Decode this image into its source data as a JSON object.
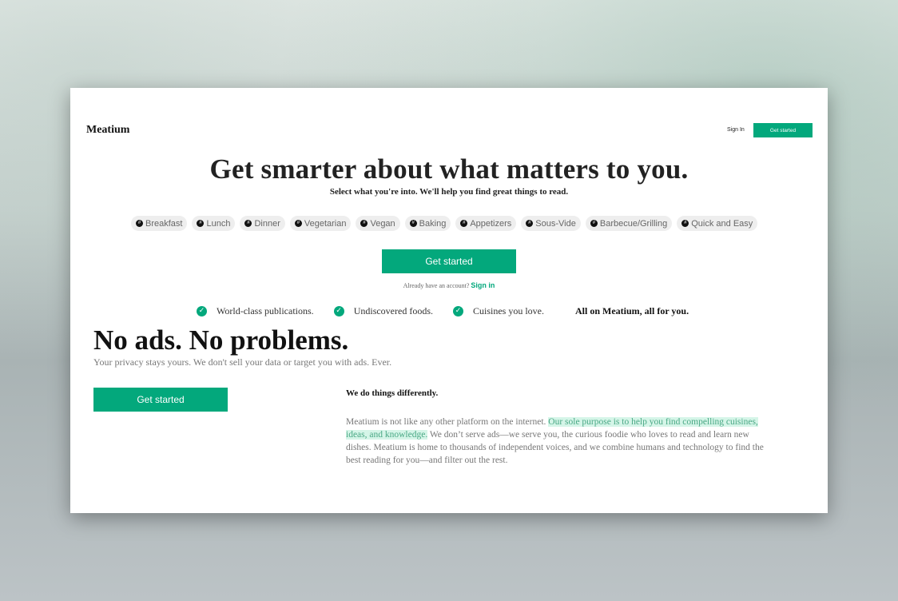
{
  "header": {
    "logo": "Meatium",
    "sign_in": "Sign In",
    "get_started": "Get started"
  },
  "hero": {
    "title": "Get smarter about what matters to you.",
    "subtitle": "Select what you're into. We'll help you find great things to read."
  },
  "tags": [
    "Breakfast",
    "Lunch",
    "Dinner",
    "Vegetarian",
    "Vegan",
    "Baking",
    "Appetizers",
    "Sous-Vide",
    "Barbecue/Grilling",
    "Quick and Easy"
  ],
  "cta": {
    "label": "Get started",
    "already": "Already have an account?",
    "sign_in": "Sign in"
  },
  "features": {
    "items": [
      "World-class publications.",
      "Undiscovered foods.",
      "Cuisines you love."
    ],
    "final": "All on Meatium, all for you."
  },
  "no_ads": {
    "title": "No ads. No problems.",
    "subtitle": "Your privacy stays yours. We don't sell your data or target you with ads. Ever.",
    "cta": "Get started"
  },
  "different": {
    "title": "We do things differently.",
    "body_start": "Meatium is not like any other platform on the internet. ",
    "body_highlight": "Our sole purpose is to help you find compelling cuisines, ideas, and knowledge.",
    "body_end": " We don’t serve ads—we serve you, the curious foodie who loves to read and learn new dishes. Meatium is home to thousands of independent voices, and we combine humans and technology to find the best reading for you—and filter out the rest."
  },
  "colors": {
    "accent": "#03a87c",
    "highlight": "#d5f5e8"
  }
}
